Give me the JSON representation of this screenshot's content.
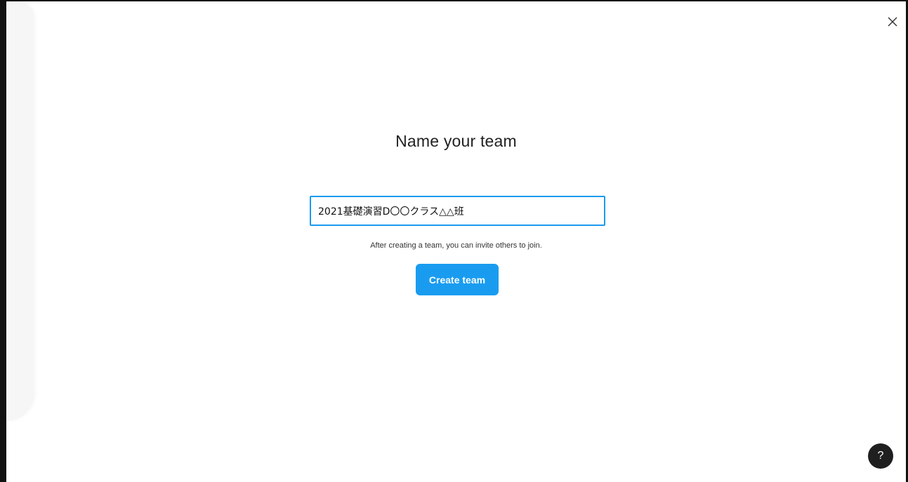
{
  "dialog": {
    "title": "Name your team",
    "team_name_value": "2021基礎演習D〇〇クラス△△班",
    "hint": "After creating a team, you can invite others to join.",
    "create_button_label": "Create team"
  },
  "help": {
    "label": "?"
  },
  "icons": {
    "close": "close-icon",
    "help": "help-icon"
  },
  "colors": {
    "accent": "#199cf0",
    "input_border": "#1b9bef",
    "help_bg": "#1f1f1f"
  }
}
